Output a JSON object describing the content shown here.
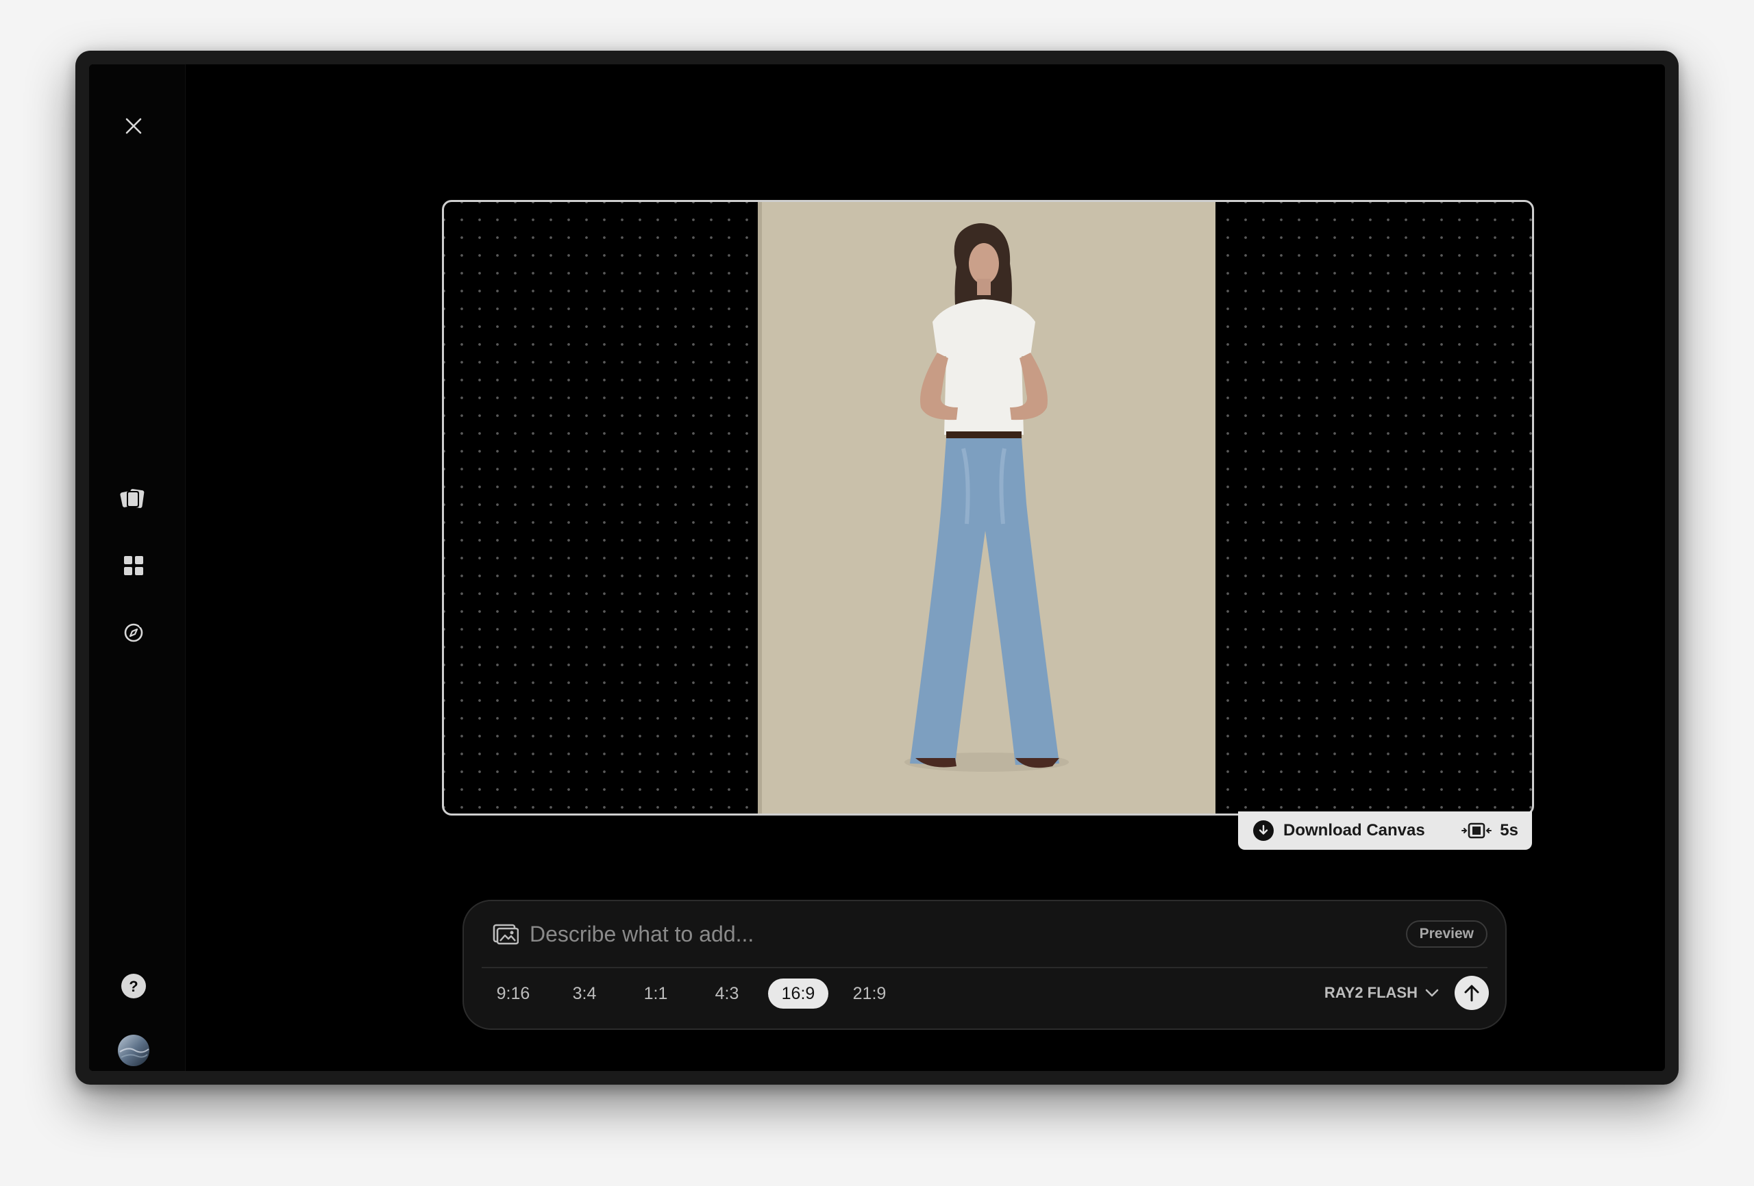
{
  "canvas": {
    "download_label": "Download Canvas",
    "duration_label": "5s"
  },
  "prompt": {
    "placeholder": "Describe what to add...",
    "preview_label": "Preview",
    "ratios": [
      "9:16",
      "3:4",
      "1:1",
      "4:3",
      "16:9",
      "21:9"
    ],
    "active_ratio": "16:9",
    "model_label": "RAY2 FLASH"
  },
  "icons": {
    "close": "close-icon",
    "boards": "cards-icon",
    "grid": "grid-icon",
    "ideas": "compass-icon",
    "help": "help-icon",
    "avatar": "avatar",
    "download": "download-icon",
    "duration": "film-frame-icon",
    "image_upload": "image-upload-icon",
    "model_chevron": "chevron-down-icon",
    "submit": "arrow-up-icon"
  },
  "colors": {
    "background": "#000000",
    "accent": "#e8e8e8",
    "photo_backdrop": "#c9c0aa"
  }
}
